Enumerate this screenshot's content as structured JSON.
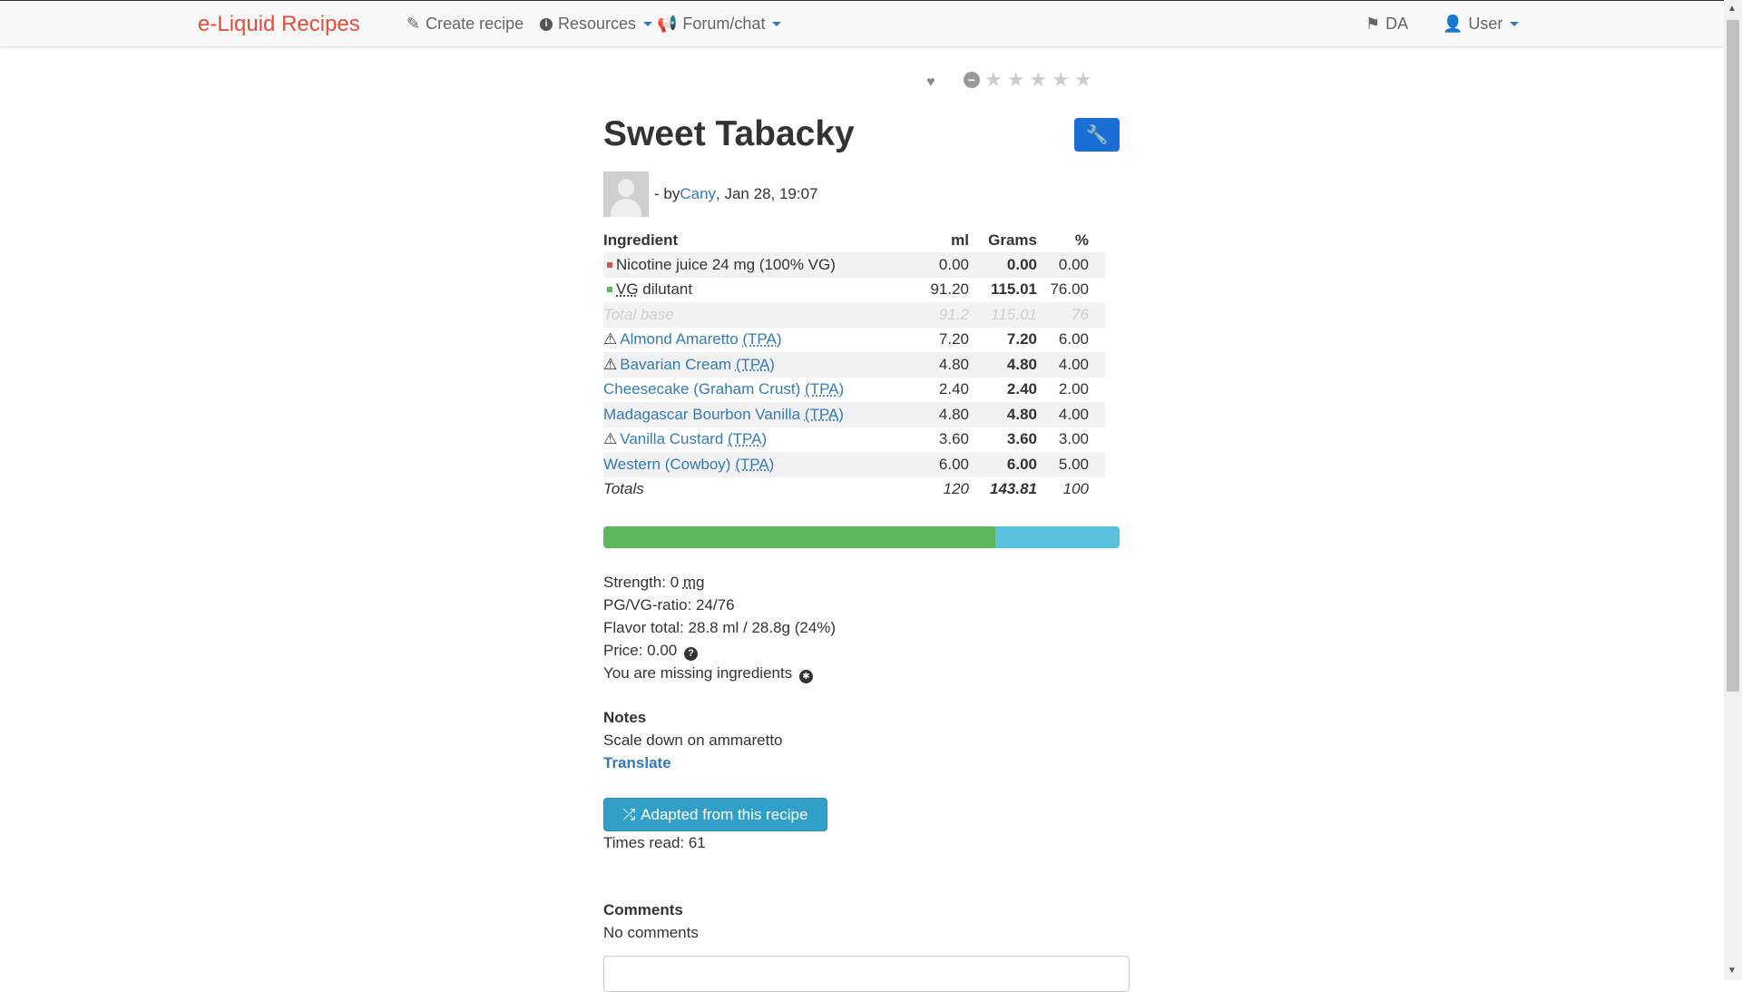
{
  "nav": {
    "brand": "e-Liquid Recipes",
    "create": "Create recipe",
    "resources": "Resources",
    "forum": "Forum/chat",
    "lang": "DA",
    "user": "User"
  },
  "recipe": {
    "title": "Sweet Tabacky",
    "by_prefix": "- by ",
    "author": "Cany",
    "date": ", Jan 28, 19:07",
    "rating_stars": 0,
    "headers": {
      "ingredient": "Ingredient",
      "ml": "ml",
      "grams": "Grams",
      "pct": "%"
    },
    "base_rows": [
      {
        "name": "Nicotine juice 24 mg (100% VG)",
        "ml": "0.00",
        "grams": "0.00",
        "pct": "0.00",
        "marker_color": "#d9534f"
      },
      {
        "name_abbr": "VG",
        "name": " dilutant",
        "ml": "91.20",
        "grams": "115.01",
        "pct": "76.00",
        "marker_color": "#5cb85c"
      }
    ],
    "total_base": {
      "label": "Total base",
      "ml": "91.2",
      "grams": "115.01",
      "pct": "76"
    },
    "flavors": [
      {
        "warn": true,
        "name": "Almond Amaretto",
        "brand": "(TPA)",
        "ml": "7.20",
        "grams": "7.20",
        "pct": "6.00"
      },
      {
        "warn": true,
        "name": "Bavarian Cream",
        "brand": "(TPA)",
        "ml": "4.80",
        "grams": "4.80",
        "pct": "4.00"
      },
      {
        "warn": false,
        "name": "Cheesecake (Graham Crust)",
        "brand": "(TPA)",
        "ml": "2.40",
        "grams": "2.40",
        "pct": "2.00"
      },
      {
        "warn": false,
        "name": "Madagascar Bourbon Vanilla",
        "brand": "(TPA)",
        "ml": "4.80",
        "grams": "4.80",
        "pct": "4.00"
      },
      {
        "warn": true,
        "name": "Vanilla Custard",
        "brand": "(TPA)",
        "ml": "3.60",
        "grams": "3.60",
        "pct": "3.00"
      },
      {
        "warn": false,
        "name": "Western (Cowboy)",
        "brand": "(TPA)",
        "ml": "6.00",
        "grams": "6.00",
        "pct": "5.00"
      }
    ],
    "totals": {
      "label": "Totals",
      "ml": "120",
      "grams": "143.81",
      "pct": "100"
    },
    "vg_fraction_pct": 76,
    "stats": {
      "strength_label": "Strength: 0 ",
      "strength_unit": "mg",
      "ratio": "PG/VG-ratio: 24/76",
      "flavor_total": "Flavor total: 28.8 ml / 28.8g (24%)",
      "price": "Price: 0.00",
      "missing": "You are missing ingredients"
    },
    "notes_heading": "Notes",
    "notes_text": "Scale down on ammaretto",
    "translate": "Translate",
    "adapt_button": "Adapted from this recipe",
    "times_read": "Times read: 61",
    "comments_heading": "Comments",
    "comments_text": "No comments"
  },
  "colors": {
    "brand": "#e74c3c",
    "link": "#337ab7",
    "vg": "#5cb85c",
    "pg": "#5bc0de",
    "edit": "#1a6fd6"
  }
}
